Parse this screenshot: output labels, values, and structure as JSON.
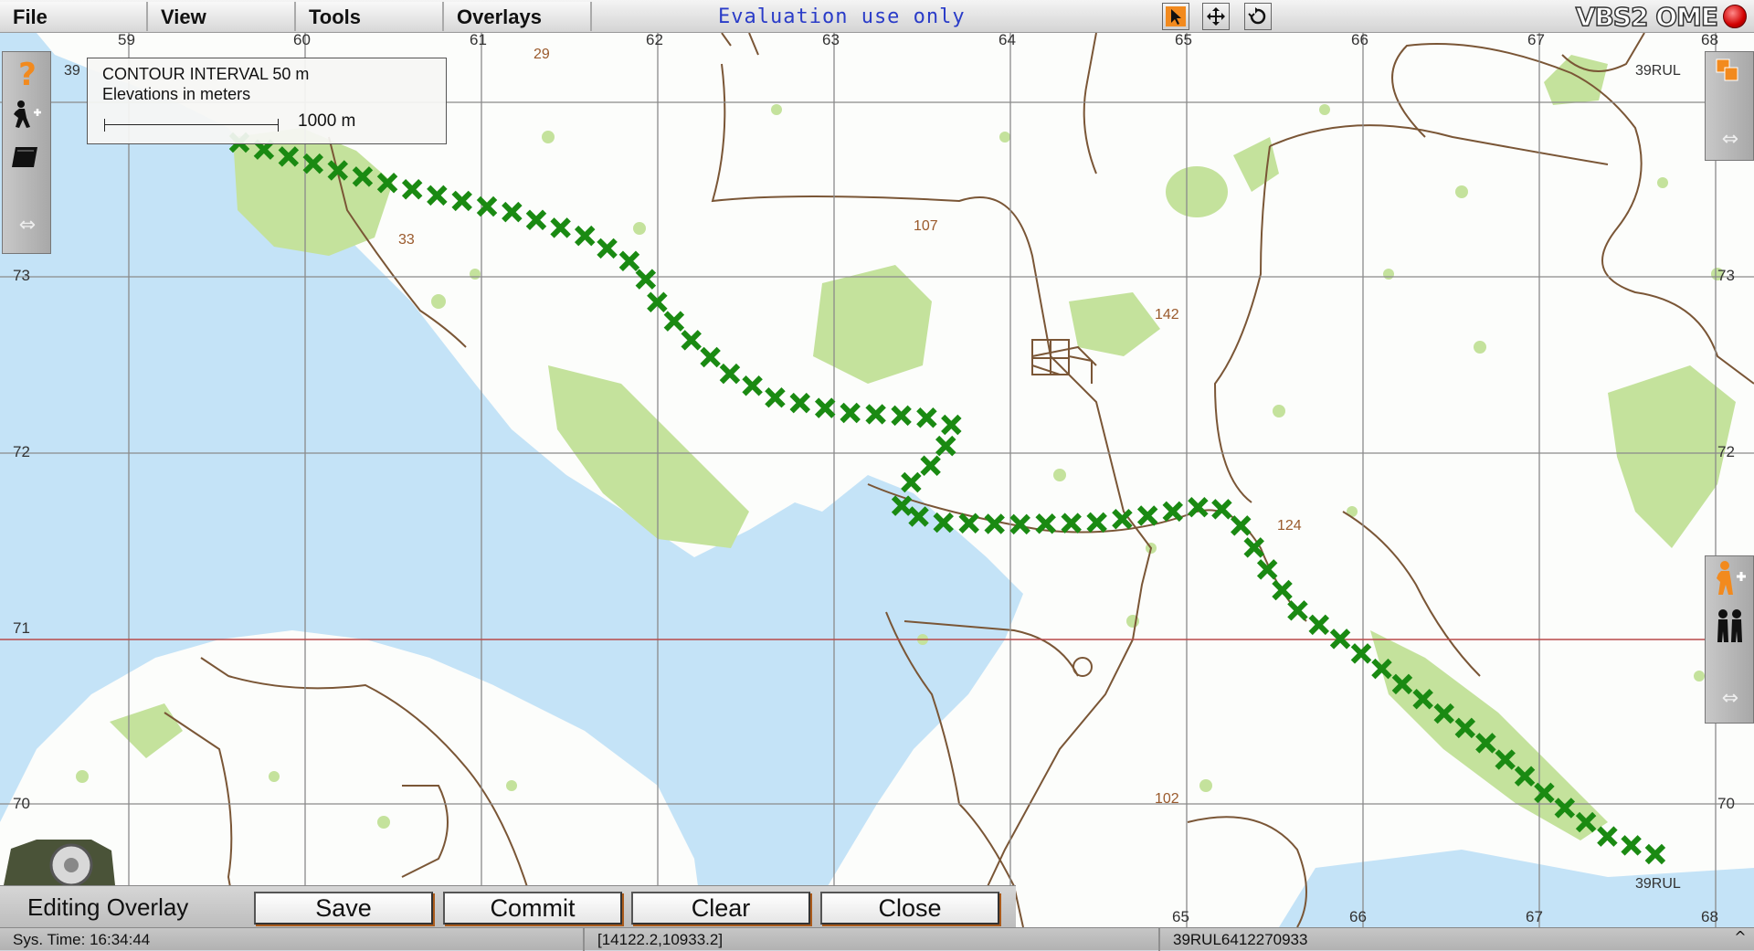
{
  "menu": [
    "File",
    "View",
    "Tools",
    "Overlays"
  ],
  "eval_note": "Evaluation use only",
  "brand": "VBS2 OME",
  "map": {
    "grid_top_labels": [
      "59",
      "60",
      "61",
      "62",
      "63",
      "64",
      "65",
      "66",
      "67",
      "68"
    ],
    "grid_bottom_labels": [
      "65",
      "66",
      "67",
      "68"
    ],
    "grid_row_labels": [
      "73",
      "72",
      "71",
      "70"
    ],
    "grid_zone_label": "39RUL",
    "grid_zone_label_topleft": "39",
    "elevation_labels": [
      "29",
      "33",
      "107",
      "142",
      "124",
      "102"
    ],
    "legend": {
      "title": "CONTOUR INTERVAL 50 m",
      "units": "Elevations in meters",
      "scale": "1000 m"
    },
    "route_color": "#1a8a12",
    "route_marker": "x-cross"
  },
  "side_tools": {
    "left": [
      "help-icon",
      "add-unit-icon",
      "overlay-layer-icon",
      "collapse-arrows-icon"
    ],
    "right_top": [
      "layers-icon",
      "collapse-arrows-icon"
    ],
    "right_bottom": [
      "add-soldier-icon",
      "group-icon",
      "collapse-arrows-icon"
    ]
  },
  "edit_bar": {
    "label": "Editing Overlay",
    "buttons": [
      "Save",
      "Commit",
      "Clear",
      "Close"
    ]
  },
  "status": {
    "sys_time": "Sys. Time: 16:34:44",
    "coords": "[14122.2,10933.2]",
    "grid_ref": "39RUL6412270933",
    "corner": "^"
  }
}
